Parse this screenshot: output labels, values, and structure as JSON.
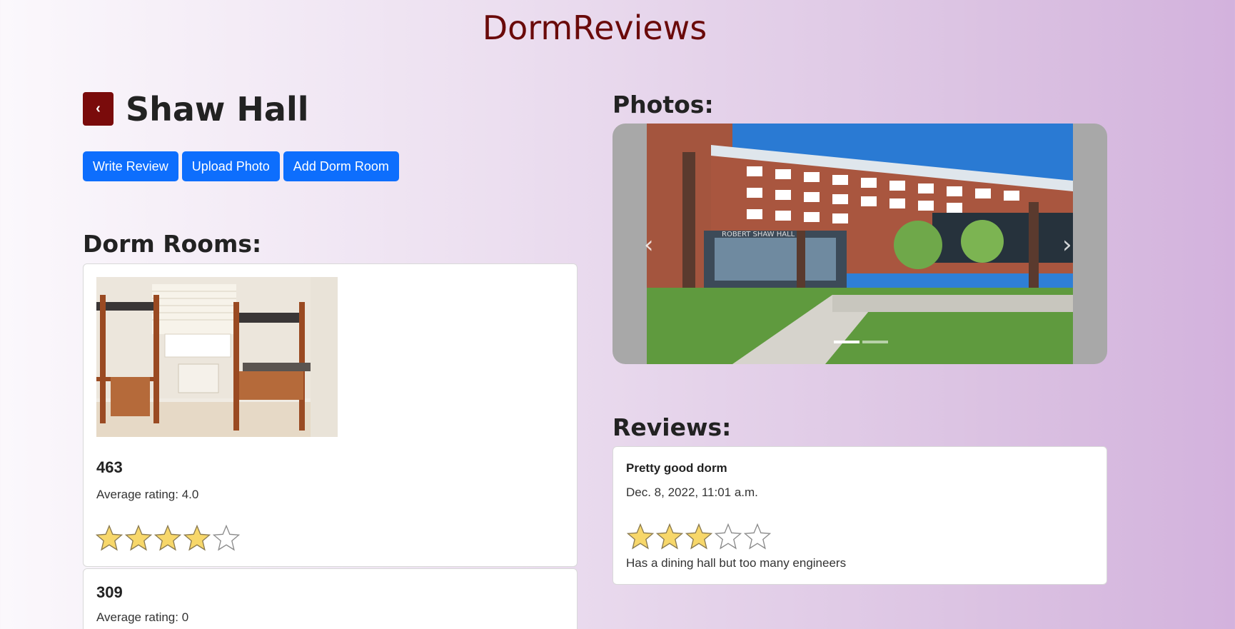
{
  "site": {
    "title": "DormReviews"
  },
  "dorm": {
    "back_label": "‹",
    "name": "Shaw Hall"
  },
  "actions": {
    "write_review": "Write Review",
    "upload_photo": "Upload Photo",
    "add_dorm_room": "Add Dorm Room"
  },
  "rooms_section": {
    "heading": "Dorm Rooms:",
    "rooms": [
      {
        "number": "463",
        "average_label": "Average rating: 4.0",
        "rating": 4,
        "max_rating": 5
      },
      {
        "number": "309",
        "average_label": "Average rating: 0",
        "rating": 0,
        "max_rating": 5
      }
    ]
  },
  "photos_section": {
    "heading": "Photos:",
    "building_sign": "ROBERT SHAW HALL",
    "prev_label": "‹",
    "next_label": "›",
    "slide_count": 2,
    "active_slide": 1
  },
  "reviews_section": {
    "heading": "Reviews:",
    "reviews": [
      {
        "title": "Pretty good dorm",
        "date": "Dec. 8, 2022, 11:01 a.m.",
        "rating": 3,
        "max_rating": 5,
        "body": "Has a dining hall but too many engineers"
      }
    ]
  },
  "colors": {
    "brand": "#6a0a0a",
    "back_button": "#7a0b0b",
    "primary_button": "#0d6efd",
    "star_fill": "#f7d76a",
    "star_stroke": "#8a7a50"
  }
}
